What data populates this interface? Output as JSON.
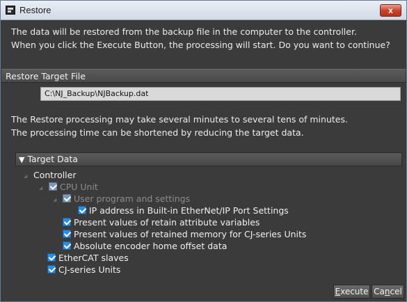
{
  "window": {
    "title": "Restore",
    "close_glyph": "x"
  },
  "intro": {
    "line1": "The data will be restored from the backup file in the computer to the controller.",
    "line2": "When you click the Execute Button, the processing will start. Do you want to continue?"
  },
  "restore_target": {
    "header": "Restore Target File",
    "path": "C:\\NJ_Backup\\NJBackup.dat"
  },
  "note": {
    "line1": "The Restore processing may take several minutes to several tens of minutes.",
    "line2": "The processing time can be shortened by reducing the target data."
  },
  "target_data": {
    "header": "Target Data",
    "tree": [
      {
        "label": "Controller",
        "checked": null,
        "enabled": true
      },
      {
        "label": "CPU Unit",
        "checked": true,
        "enabled": false
      },
      {
        "label": "User program and settings",
        "checked": true,
        "enabled": false
      },
      {
        "label": "IP address in Built-in EtherNet/IP Port Settings",
        "checked": true,
        "enabled": true
      },
      {
        "label": "Present values of retain attribute variables",
        "checked": true,
        "enabled": true
      },
      {
        "label": "Present values of retained memory for CJ-series Units",
        "checked": true,
        "enabled": true
      },
      {
        "label": "Absolute encoder home offset data",
        "checked": true,
        "enabled": true
      },
      {
        "label": "EtherCAT slaves",
        "checked": true,
        "enabled": true
      },
      {
        "label": "CJ-series Units",
        "checked": true,
        "enabled": true
      }
    ]
  },
  "buttons": {
    "execute_pre": "",
    "execute_key": "E",
    "execute_post": "xecute",
    "cancel_pre": "Ca",
    "cancel_key": "n",
    "cancel_post": "cel"
  }
}
